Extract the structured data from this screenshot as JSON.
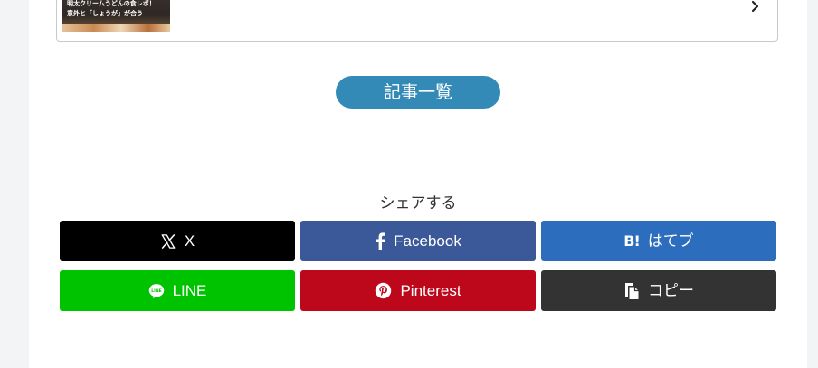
{
  "related_card": {
    "thumb_caption_line1": "明太クリームうどんの食レポ！",
    "thumb_caption_line2": "意外と「しょうが」が合う"
  },
  "article_list_button": {
    "label": "記事一覧"
  },
  "share": {
    "title": "シェアする",
    "buttons": [
      {
        "label": "X",
        "icon": "x-logo-icon",
        "color": "#000000"
      },
      {
        "label": "Facebook",
        "icon": "facebook-icon",
        "color": "#3b5998"
      },
      {
        "label": "はてブ",
        "icon": "hatena-bookmark-icon",
        "icon_text": "B!",
        "color": "#2c6ebd"
      },
      {
        "label": "LINE",
        "icon": "line-icon",
        "color": "#00c300"
      },
      {
        "label": "Pinterest",
        "icon": "pinterest-icon",
        "color": "#bd081c"
      },
      {
        "label": "コピー",
        "icon": "copy-icon",
        "color": "#333333"
      }
    ]
  },
  "colors": {
    "accent": "#338ab7",
    "page_background": "#f3f4f6"
  }
}
